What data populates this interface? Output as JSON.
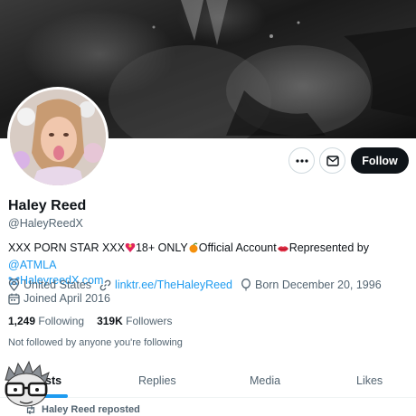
{
  "profile": {
    "name": "Haley Reed",
    "handle": "@HaleyReedX",
    "bio_part1": "XXX PORN STAR XXX",
    "bio_part2": "18+ ONLY",
    "bio_part3": "Official Account",
    "bio_part4": "Represented by ",
    "bio_mention": "@ATMLA",
    "bio_link": "HaleyreedX.com",
    "location": "United States",
    "website": "linktr.ee/TheHaleyReed",
    "born": "Born December 20, 1996",
    "joined": "Joined April 2016",
    "following_count": "1,249",
    "following_label": "Following",
    "followers_count": "319K",
    "followers_label": "Followers",
    "not_followed_text": "Not followed by anyone you're following"
  },
  "actions": {
    "follow_label": "Follow"
  },
  "tabs": [
    {
      "label": "Posts"
    },
    {
      "label": "Replies"
    },
    {
      "label": "Media"
    },
    {
      "label": "Likes"
    }
  ],
  "tabs_visible": {
    "posts_partial": "sts"
  },
  "feed": {
    "repost_text": "Haley Reed reposted"
  },
  "colors": {
    "accent": "#1d9bf0",
    "text": "#0f1419",
    "muted": "#536471",
    "follow_bg": "#0f1419"
  },
  "icons": [
    "more-icon",
    "mail-icon",
    "location-icon",
    "link-icon",
    "balloon-icon",
    "calendar-icon",
    "repost-icon",
    "butterfly-icon"
  ]
}
